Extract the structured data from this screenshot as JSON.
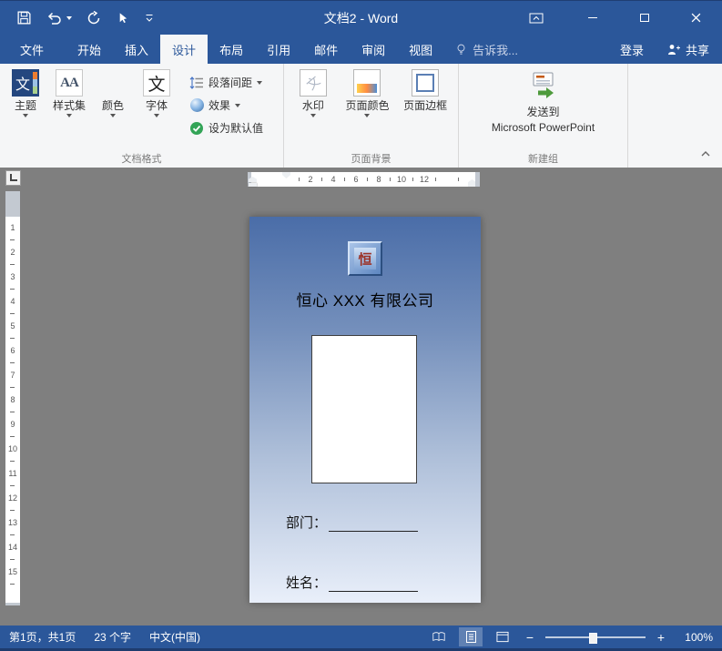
{
  "window": {
    "title": "文档2 - Word"
  },
  "tabs": [
    "文件",
    "开始",
    "插入",
    "设计",
    "布局",
    "引用",
    "邮件",
    "审阅",
    "视图"
  ],
  "tell_me": "告诉我...",
  "account": {
    "sign_in": "登录",
    "share": "共享"
  },
  "ribbon": {
    "doc_format": {
      "label": "文档格式",
      "themes": "主题",
      "style_set": "样式集",
      "colors": "颜色",
      "fonts": "字体",
      "paragraph_spacing": "段落间距",
      "effects": "效果",
      "set_default": "设为默认值"
    },
    "page_background": {
      "label": "页面背景",
      "watermark": "水印",
      "page_color": "页面颜色",
      "page_borders": "页面边框"
    },
    "custom_group": {
      "label": "新建组",
      "send_line1": "发送到",
      "send_line2": "Microsoft PowerPoint"
    }
  },
  "icons": {
    "themes_glyph": "文",
    "style_set_glyph": "AA",
    "fonts_glyph": "文",
    "watermark_glyph": "文"
  },
  "ruler": {
    "horizontal": [
      "2",
      "4",
      "6",
      "8",
      "10",
      "12"
    ],
    "vertical": [
      "1",
      "2",
      "3",
      "4",
      "5",
      "6",
      "7",
      "8",
      "9",
      "10",
      "11",
      "12",
      "13",
      "14",
      "15"
    ]
  },
  "document": {
    "logo_char": "恒",
    "company_name": "恒心 XXX 有限公司",
    "department_label": "部门：",
    "name_label": "姓名："
  },
  "status_bar": {
    "page_info": "第1页，共1页",
    "word_count": "23 个字",
    "language": "中文(中国)",
    "zoom_level": "100%"
  },
  "colors": {
    "accent": "#2b579a",
    "canvas": "#7f7f7f",
    "card_gradient_top": "#4a6da8",
    "card_gradient_bottom": "#e9effa"
  }
}
